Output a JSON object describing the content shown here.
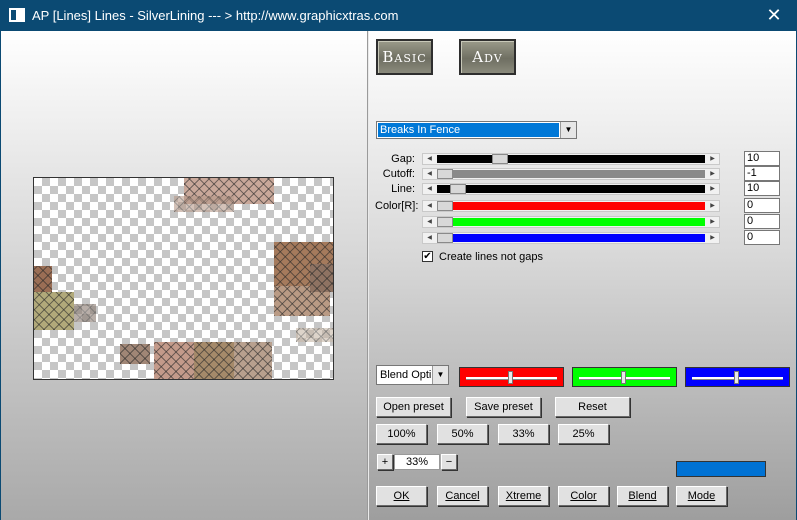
{
  "window": {
    "title": "AP [Lines]  Lines - SilverLining    --- > http://www.graphicxtras.com",
    "close_glyph": "✕"
  },
  "mode_buttons": {
    "basic": "Basic",
    "adv": "Adv"
  },
  "effect_select": {
    "value": "Breaks In Fence"
  },
  "sliders": [
    {
      "label": "Gap:",
      "value": "10",
      "color": "#000000",
      "knob": 0.22
    },
    {
      "label": "Cutoff:",
      "value": "-1",
      "color": "#8a8a8a",
      "knob": 0.0
    },
    {
      "label": "Line:",
      "value": "10",
      "color": "#000000",
      "knob": 0.05
    },
    {
      "label": "Color[R]:",
      "value": "0",
      "color": "#ff0000",
      "knob": 0.0
    },
    {
      "label": "",
      "value": "0",
      "color": "#00ff00",
      "knob": 0.0
    },
    {
      "label": "",
      "value": "0",
      "color": "#0000ff",
      "knob": 0.0
    }
  ],
  "checkbox": {
    "label": "Create lines not gaps",
    "checked": true,
    "mark": "✔"
  },
  "blend_select": {
    "value": "Blend Optio"
  },
  "color_boxes": [
    {
      "color": "#ff0000",
      "knob": 0.48
    },
    {
      "color": "#00ff00",
      "knob": 0.48
    },
    {
      "color": "#0000ff",
      "knob": 0.48
    }
  ],
  "preset_buttons": {
    "open": "Open preset",
    "save": "Save preset",
    "reset": "Reset"
  },
  "zoom_buttons": [
    "100%",
    "50%",
    "33%",
    "25%"
  ],
  "zoom": {
    "plus": "+",
    "minus": "−",
    "value": "33%"
  },
  "output_swatch": "#0072d4",
  "action_buttons": {
    "ok": "OK",
    "cancel": "Cancel",
    "xtreme": "Xtreme",
    "color": "Color",
    "blend": "Blend",
    "mode": "Mode"
  }
}
